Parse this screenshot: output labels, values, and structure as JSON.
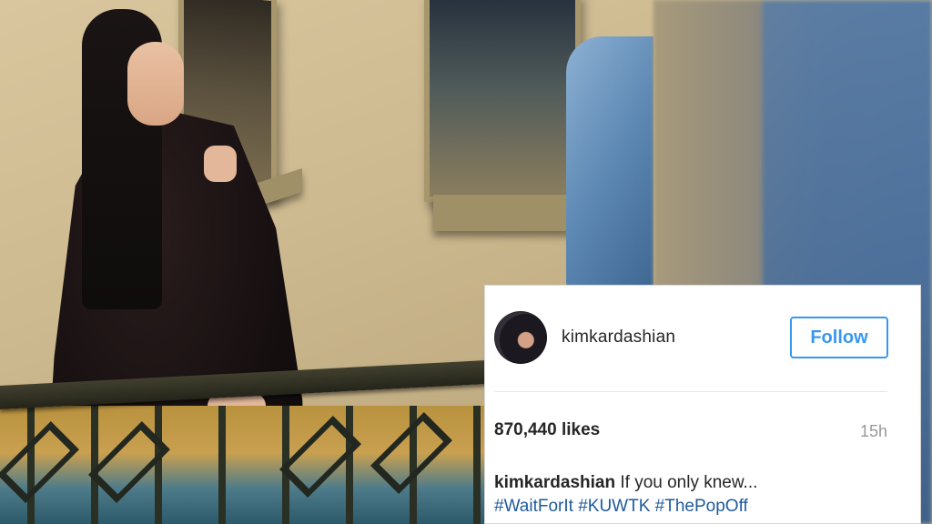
{
  "post": {
    "username": "kimkardashian",
    "follow_label": "Follow",
    "likes": "870,440 likes",
    "time": "15h",
    "caption_user": "kimkardashian",
    "caption_text": "If you only knew...",
    "hashtags": [
      "#WaitForIt",
      "#KUWTK",
      "#ThePopOff"
    ]
  },
  "colors": {
    "follow_blue": "#3897f0",
    "hashtag_blue": "#1d5a9c",
    "text_dark": "#262626",
    "timestamp_gray": "#999999"
  }
}
